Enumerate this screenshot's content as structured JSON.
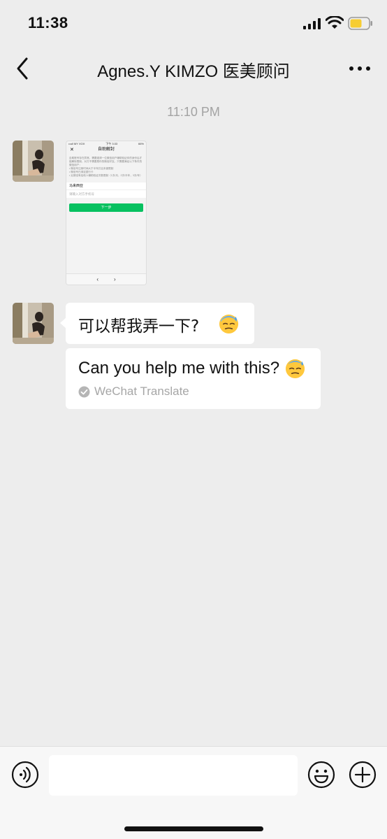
{
  "status_bar": {
    "time": "11:38",
    "battery_color": "#f7cd32"
  },
  "nav": {
    "title": "Agnes.Y KIMZO 医美顾问",
    "back_icon": "chevron-left-icon",
    "more_icon": "more-dots-icon"
  },
  "chat": {
    "timestamp": "11:10 PM",
    "image_message": {
      "status_carrier": "••ull MY XOX",
      "status_time": "下午 3:33",
      "status_battery": "66%",
      "title": "自助解封",
      "close_icon": "✕",
      "intro": "自助账号存在异常，需要邀请一位微信用户辅助验证你的身份后才能解除限制，对方不需要是你的微信好友。只需要满足以下条件的微信用户：",
      "rules": [
        "微信号注册时间大于半年并且未被限制",
        "微信号已绑定银行卡",
        "近期没有给他人辅助验证次数限制（1次/月，2次/半年，3次/年）"
      ],
      "region": "马来西亚",
      "phone_placeholder": "请输入对方手机号",
      "next_button": "下一步",
      "toolbar_back": "‹",
      "toolbar_forward": "›"
    },
    "text_message": "可以帮我弄一下?",
    "translation": {
      "text": "Can you help me with this?",
      "source": "WeChat Translate"
    }
  },
  "input_bar": {
    "placeholder": "",
    "value": ""
  },
  "colors": {
    "background": "#ededed",
    "bubble": "#ffffff",
    "wechat_green": "#07c160"
  }
}
